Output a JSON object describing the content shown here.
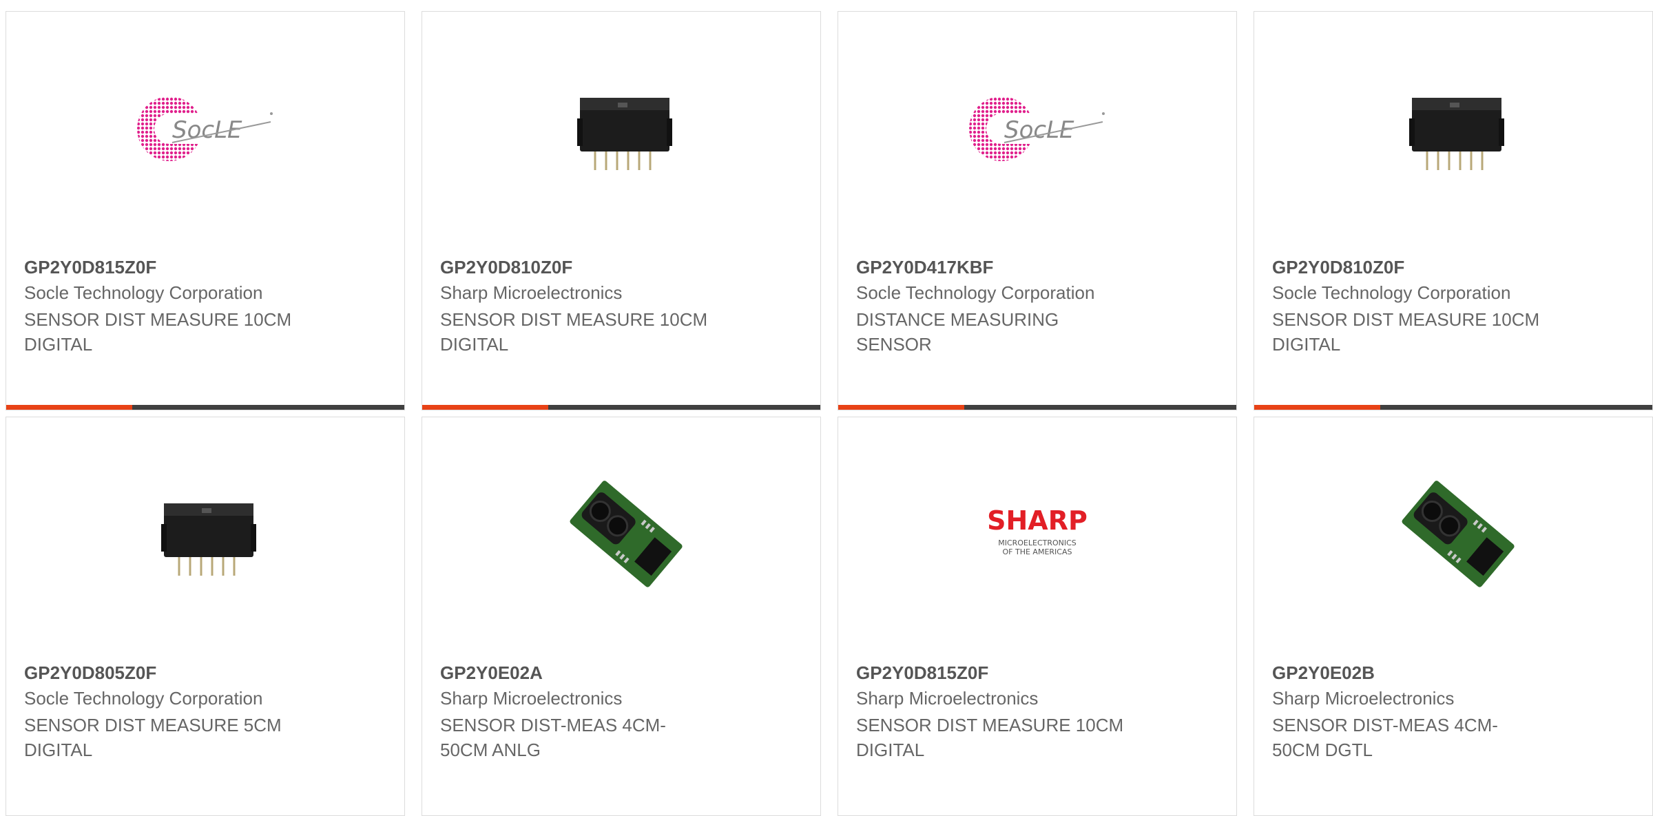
{
  "colors": {
    "accent": "#e84216",
    "bar_dark": "#404040",
    "border": "#dcdcdc"
  },
  "cards": [
    {
      "part": "GP2Y0D815Z0F",
      "manufacturer": "Socle Technology Corporation",
      "desc1": "SENSOR DIST MEASURE 10CM",
      "desc2": "DIGITAL",
      "image": "socle-logo"
    },
    {
      "part": "GP2Y0D810Z0F",
      "manufacturer": "Sharp Microelectronics",
      "desc1": "SENSOR DIST MEASURE 10CM",
      "desc2": "DIGITAL",
      "image": "black-sensor-module"
    },
    {
      "part": "GP2Y0D417KBF",
      "manufacturer": "Socle Technology Corporation",
      "desc1": "DISTANCE MEASURING",
      "desc2": "SENSOR",
      "image": "socle-logo"
    },
    {
      "part": "GP2Y0D810Z0F",
      "manufacturer": "Socle Technology Corporation",
      "desc1": "SENSOR DIST MEASURE 10CM",
      "desc2": "DIGITAL",
      "image": "black-sensor-module"
    },
    {
      "part": "GP2Y0D805Z0F",
      "manufacturer": "Socle Technology Corporation",
      "desc1": "SENSOR DIST MEASURE 5CM",
      "desc2": "DIGITAL",
      "image": "black-sensor-module"
    },
    {
      "part": "GP2Y0E02A",
      "manufacturer": "Sharp Microelectronics",
      "desc1": "SENSOR DIST-MEAS 4CM-",
      "desc2": "50CM ANLG",
      "image": "green-pcb-sensor"
    },
    {
      "part": "GP2Y0D815Z0F",
      "manufacturer": "Sharp Microelectronics",
      "desc1": "SENSOR DIST MEASURE 10CM",
      "desc2": "DIGITAL",
      "image": "sharp-logo",
      "logo_text": "SHARP",
      "logo_sub1": "MICROELECTRONICS",
      "logo_sub2": "OF THE AMERICAS"
    },
    {
      "part": "GP2Y0E02B",
      "manufacturer": "Sharp Microelectronics",
      "desc1": "SENSOR DIST-MEAS 4CM-",
      "desc2": "50CM DGTL",
      "image": "green-pcb-sensor"
    }
  ]
}
